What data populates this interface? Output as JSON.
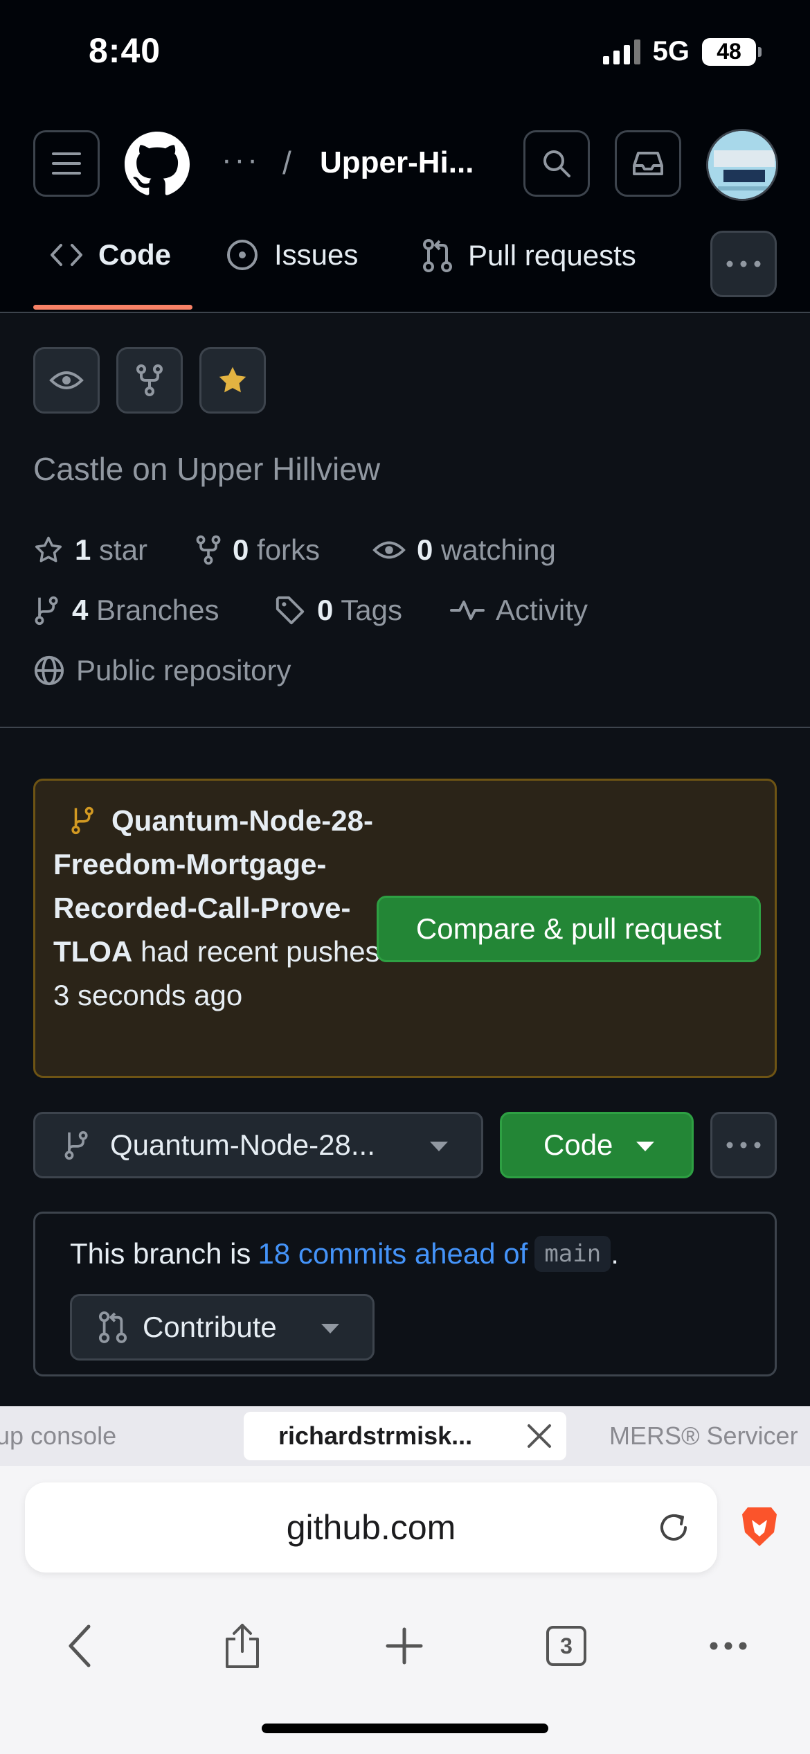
{
  "status_bar": {
    "time": "8:40",
    "network": "5G",
    "battery": "48"
  },
  "header": {
    "path_ellipsis": "···",
    "path_separator": "/",
    "repo_name": "Upper-Hi..."
  },
  "tabs": [
    {
      "label": "Code",
      "active": true
    },
    {
      "label": "Issues",
      "active": false
    },
    {
      "label": "Pull requests",
      "active": false
    }
  ],
  "repo": {
    "description": "Castle on Upper Hillview",
    "stars_count": "1",
    "stars_label": "star",
    "forks_count": "0",
    "forks_label": "forks",
    "watching_count": "0",
    "watching_label": "watching",
    "branches_count": "4",
    "branches_label": "Branches",
    "tags_count": "0",
    "tags_label": "Tags",
    "activity_label": "Activity",
    "visibility": "Public repository"
  },
  "push_banner": {
    "branch_name": "Quantum-Node-28-Freedom-Mortgage-Recorded-Call-Prove-TLOA",
    "message": "had recent pushes 3 seconds ago",
    "compare_button": "Compare & pull request"
  },
  "branch_row": {
    "selected_branch": "Quantum-Node-28...",
    "code_button": "Code"
  },
  "branch_info": {
    "prefix": "This branch is",
    "ahead_link": "18 commits ahead of",
    "base_branch": "main",
    "suffix": ".",
    "contribute_button": "Contribute"
  },
  "browser": {
    "tabs": [
      {
        "label": "up console"
      },
      {
        "label": "richardstrmisk...",
        "active": true
      },
      {
        "label": "MERS® Servicer"
      }
    ],
    "url": "github.com",
    "tab_count": "3"
  },
  "colors": {
    "accent_underline": "#f78166",
    "primary_button": "#238636",
    "link": "#4493f8",
    "star": "#e3b341"
  }
}
